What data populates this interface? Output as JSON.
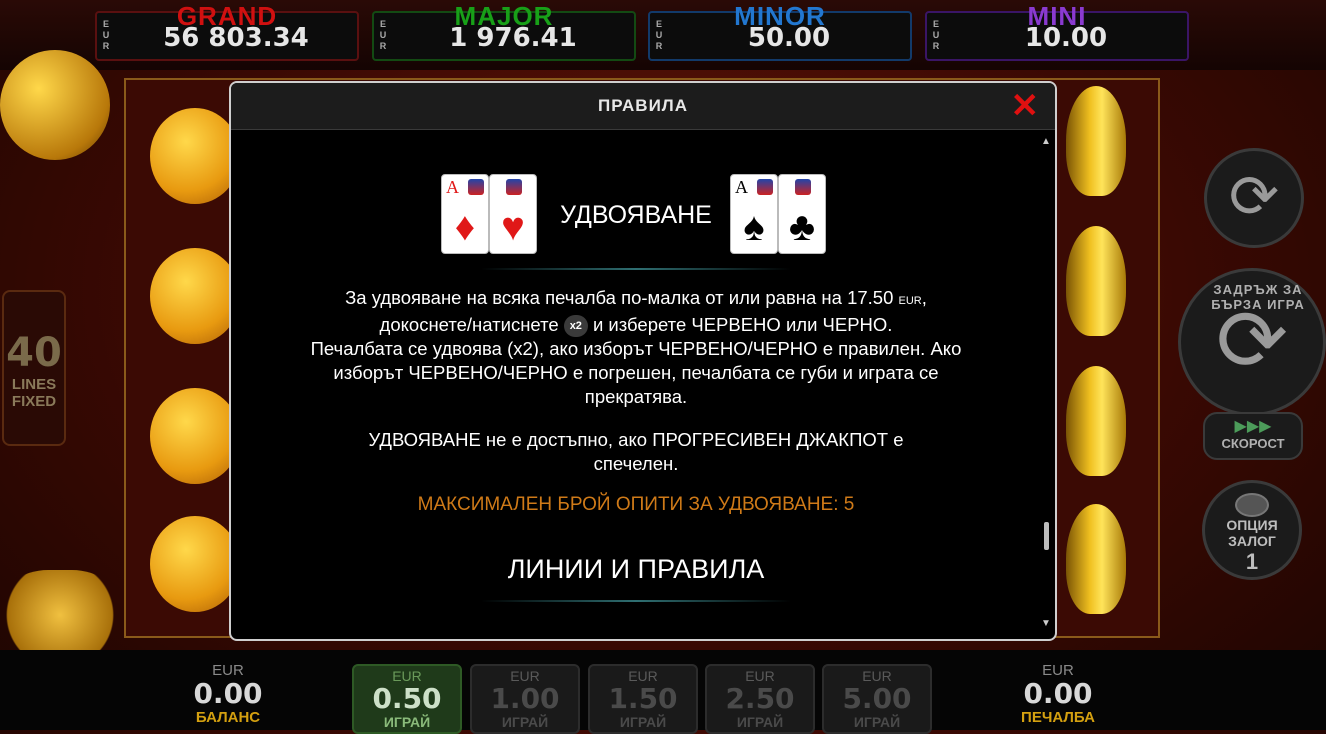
{
  "jackpots": [
    {
      "name": "GRAND",
      "currency": "EUR",
      "value": "56 803.34"
    },
    {
      "name": "MAJOR",
      "currency": "EUR",
      "value": "1 976.41"
    },
    {
      "name": "MINOR",
      "currency": "EUR",
      "value": "50.00"
    },
    {
      "name": "MINI",
      "currency": "EUR",
      "value": "10.00"
    }
  ],
  "lines": {
    "count": "40",
    "label_line1": "LINES",
    "label_line2": "FIXED"
  },
  "side": {
    "hold_label": "ЗАДРЪЖ ЗА БЪРЗА ИГРА",
    "speed_label": "СКОРОСТ",
    "bet_option_line1": "ОПЦИЯ",
    "bet_option_line2": "ЗАЛОГ",
    "bet_option_value": "1"
  },
  "bottom": {
    "balance": {
      "currency": "EUR",
      "value": "0.00",
      "label": "БАЛАНС"
    },
    "win": {
      "currency": "EUR",
      "value": "0.00",
      "label": "ПЕЧАЛБА"
    },
    "bets": [
      {
        "currency": "EUR",
        "value": "0.50",
        "label": "ИГРАЙ",
        "active": true
      },
      {
        "currency": "EUR",
        "value": "1.00",
        "label": "ИГРАЙ",
        "active": false
      },
      {
        "currency": "EUR",
        "value": "1.50",
        "label": "ИГРАЙ",
        "active": false
      },
      {
        "currency": "EUR",
        "value": "2.50",
        "label": "ИГРАЙ",
        "active": false
      },
      {
        "currency": "EUR",
        "value": "5.00",
        "label": "ИГРАЙ",
        "active": false
      }
    ]
  },
  "modal": {
    "title": "ПРАВИЛА",
    "close_icon": "close-icon",
    "double": {
      "title": "УДВОЯВАНЕ",
      "cards_red": {
        "rank": "A",
        "suits": [
          "♦",
          "♥"
        ]
      },
      "cards_black": {
        "rank": "A",
        "suits": [
          "♠",
          "♣"
        ]
      },
      "p1_a": "За удвояване на всяка печалба по-малка от или равна на 17.50",
      "p1_cur": "EUR",
      "p1_b": ",",
      "p1_c": "докоснете/натиснете",
      "p1_badge": "x2",
      "p1_d": "и изберете ЧЕРВЕНО или ЧЕРНО.",
      "p1_e": "Печалбата се удвоява (x2), ако изборът ЧЕРВЕНО/ЧЕРНО е правилен. Ако изборът ЧЕРВЕНО/ЧЕРНО е погрешен, печалбата се губи и играта се прекратява.",
      "p2": "УДВОЯВАНЕ не е достъпно, ако ПРОГРЕСИВЕН ДЖАКПОТ е спечелен.",
      "max": "МАКСИМАЛЕН БРОЙ ОПИТИ ЗА УДВОЯВАНЕ: 5"
    },
    "next_section": "ЛИНИИ И ПРАВИЛА"
  },
  "colors": {
    "accent_orange": "#cf7a18",
    "close_red": "#e01010",
    "active_bet": "#1f3a1a"
  }
}
